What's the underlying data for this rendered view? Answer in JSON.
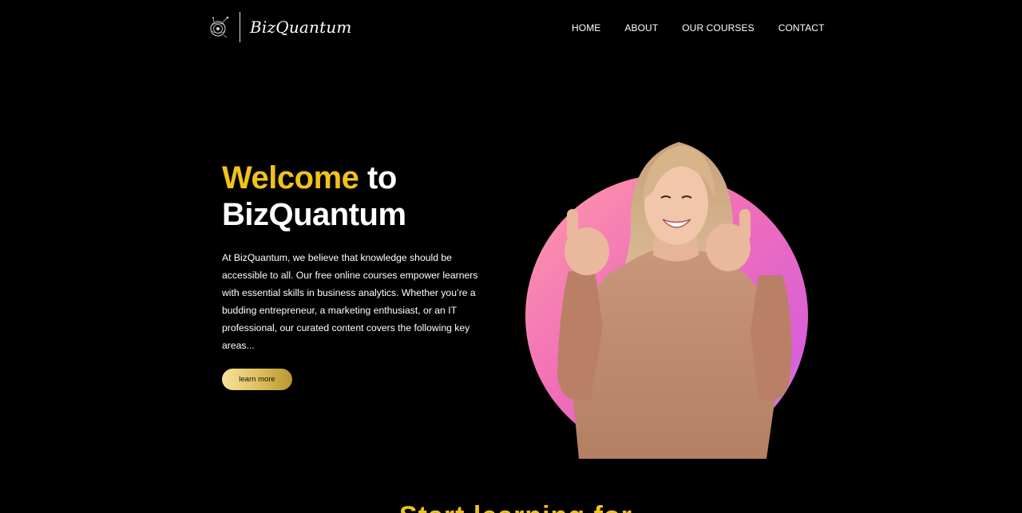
{
  "brand": {
    "name": "BizQuantum",
    "logo_icon": "globe-icon"
  },
  "nav": {
    "items": [
      {
        "label": "HOME"
      },
      {
        "label": "ABOUT"
      },
      {
        "label": "OUR COURSES"
      },
      {
        "label": "CONTACT"
      }
    ]
  },
  "hero": {
    "title_accent": "Welcome",
    "title_rest": " to",
    "title_line2": "BizQuantum",
    "description": "At BizQuantum, we believe that knowledge should be accessible to all. Our free online courses empower learners with essential skills in business analytics. Whether you’re a budding entrepreneur, a marketing enthusiast, or an IT professional, our curated content covers the following key areas...",
    "cta_label": "learn more",
    "accent_color": "#f1c21c"
  },
  "next_section": {
    "title": "Start learning for"
  }
}
